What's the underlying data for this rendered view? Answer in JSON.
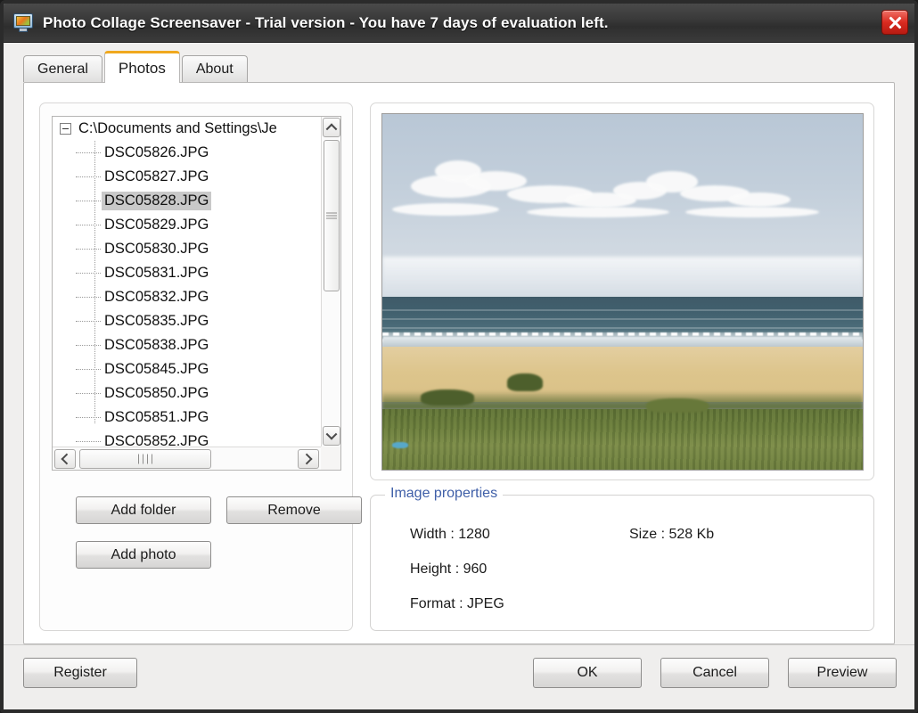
{
  "window": {
    "title": "Photo Collage Screensaver - Trial version - You have 7 days of evaluation left.",
    "icon": "photo-screensaver-icon",
    "close_label": "close-icon"
  },
  "tabs": [
    {
      "label": "General",
      "active": false
    },
    {
      "label": "Photos",
      "active": true
    },
    {
      "label": "About",
      "active": false
    }
  ],
  "tree": {
    "root": "C:\\Documents and Settings\\Je",
    "selected": "DSC05828.JPG",
    "items": [
      "DSC05826.JPG",
      "DSC05827.JPG",
      "DSC05828.JPG",
      "DSC05829.JPG",
      "DSC05830.JPG",
      "DSC05831.JPG",
      "DSC05832.JPG",
      "DSC05835.JPG",
      "DSC05838.JPG",
      "DSC05845.JPG",
      "DSC05850.JPG",
      "DSC05851.JPG",
      "DSC05852.JPG"
    ]
  },
  "left_buttons": {
    "add_folder": "Add folder",
    "remove": "Remove",
    "add_photo": "Add photo"
  },
  "image_properties": {
    "legend": "Image properties",
    "width": "Width : 1280",
    "height": "Height : 960",
    "format": "Format : JPEG",
    "size": "Size : 528 Kb"
  },
  "bottom_buttons": {
    "register": "Register",
    "ok": "OK",
    "cancel": "Cancel",
    "preview": "Preview"
  },
  "colors": {
    "tab_accent": "#f0a81e",
    "legend_blue": "#3f5fa8",
    "close_red": "#d92b20",
    "titlebar": "#3a3a3a"
  }
}
